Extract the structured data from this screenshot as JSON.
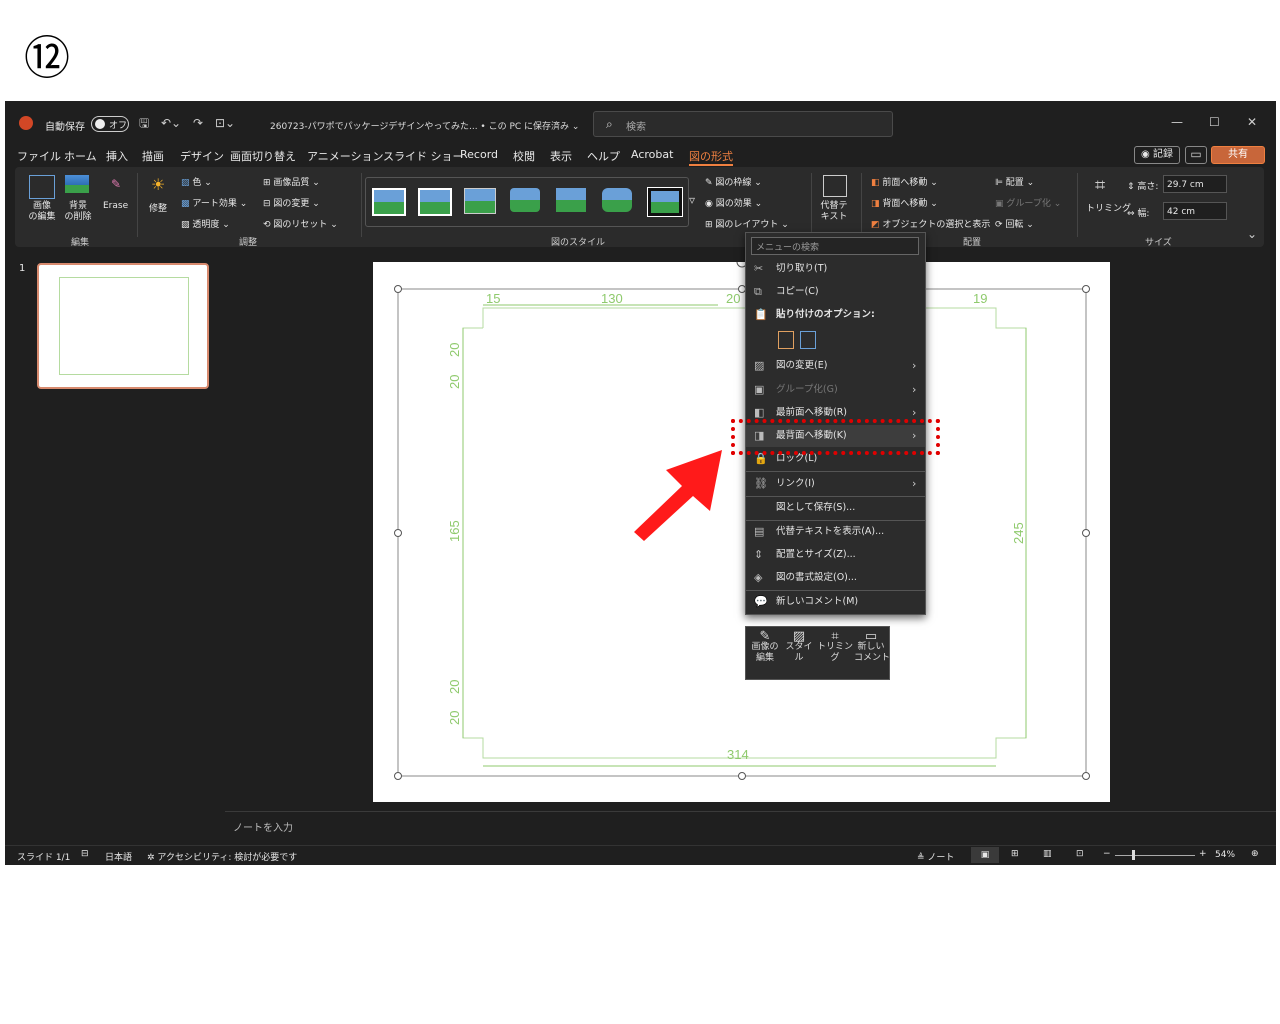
{
  "step_label": "⑫",
  "titlebar": {
    "autosave_label": "自動保存",
    "autosave_state": "オフ",
    "doc_title": "260723-パワポでパッケージデザインやってみた... • この PC に保存済み ⌄",
    "search_placeholder": "検索"
  },
  "menu": [
    "ファイル",
    "ホーム",
    "挿入",
    "描画",
    "デザイン",
    "画面切り替え",
    "アニメーション",
    "スライド ショー",
    "Record",
    "校閲",
    "表示",
    "ヘルプ",
    "Acrobat",
    "図の形式"
  ],
  "top_buttons": {
    "record": "◉ 記録",
    "share": "共有"
  },
  "ribbon": {
    "edit_image": "画像\nの編集",
    "remove_bg": "背景\nの削除",
    "erase": "Erase",
    "adjust": "修整",
    "color": "色",
    "art_effect": "アート効果",
    "transparency": "透明度",
    "compress": "画像品質",
    "change_pic": "図の変更",
    "reset_pic": "図のリセット",
    "border": "図の枠線",
    "effect": "図の効果",
    "layout": "図のレイアウト",
    "alt_text": "代替テ\nキスト",
    "bring_forward": "前面へ移動",
    "send_backward": "背面へ移動",
    "selection_pane": "オブジェクトの選択と表示",
    "align": "配置",
    "group": "グループ化",
    "rotate": "回転",
    "crop": "トリミング",
    "height_label": "高さ:",
    "height_value": "29.7 cm",
    "width_label": "幅:",
    "width_value": "42 cm",
    "groups": [
      "編集",
      "調整",
      "図のスタイル",
      "配置",
      "サイズ"
    ]
  },
  "slide_number": "1",
  "dims": {
    "top1": "15",
    "top2": "130",
    "top3": "20",
    "top4": "19",
    "left1": "20",
    "left2": "20",
    "left3": "165",
    "left4": "20",
    "left5": "20",
    "right": "245",
    "bottom": "314"
  },
  "context_menu": {
    "search": "メニューの検索",
    "items": [
      {
        "label": "切り取り(T)",
        "icon": "✂"
      },
      {
        "label": "コピー(C)",
        "icon": "⧉"
      },
      {
        "label": "貼り付けのオプション:",
        "icon": "📋"
      },
      {
        "label": "図の変更(E)",
        "icon": "▨"
      },
      {
        "label": "グループ化(G)",
        "icon": "▣"
      },
      {
        "label": "最前面へ移動(R)",
        "icon": "◧"
      },
      {
        "label": "最背面へ移動(K)",
        "icon": "◨"
      },
      {
        "label": "ロック(L)",
        "icon": "🔒"
      },
      {
        "label": "リンク(I)",
        "icon": "⛓"
      },
      {
        "label": "図として保存(S)...",
        "icon": ""
      },
      {
        "label": "代替テキストを表示(A)...",
        "icon": "▤"
      },
      {
        "label": "配置とサイズ(Z)...",
        "icon": "⇕"
      },
      {
        "label": "図の書式設定(O)...",
        "icon": "◈"
      },
      {
        "label": "新しいコメント(M)",
        "icon": "💬"
      }
    ]
  },
  "mini_toolbar": [
    "画像の\n編集",
    "スタイ\nル",
    "トリミング",
    "新しい\nコメント"
  ],
  "notes_placeholder": "ノートを入力",
  "status": {
    "slide": "スライド 1/1",
    "lang": "日本語",
    "accessibility": "アクセシビリティ: 検討が必要です",
    "notes": "ノート",
    "zoom": "54%"
  },
  "colors": {
    "accent": "#f08040",
    "highlight_box": "#e00000",
    "arrow": "#ff0000",
    "dimension_green": "#8fca6d"
  }
}
